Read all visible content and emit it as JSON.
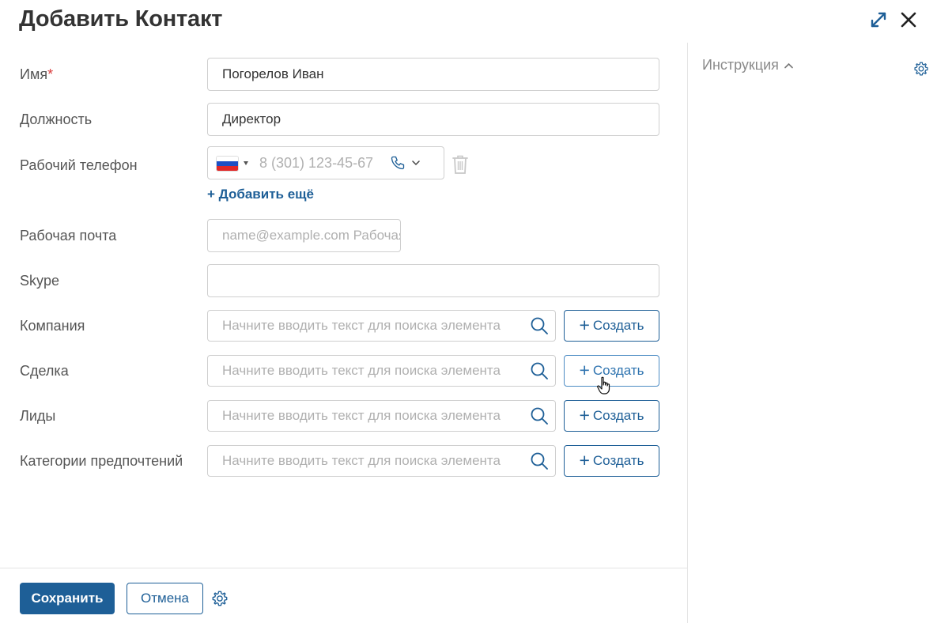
{
  "header": {
    "title": "Добавить Контакт"
  },
  "fields": {
    "name": {
      "label": "Имя",
      "required_mark": "*",
      "value": "Погорелов Иван"
    },
    "position": {
      "label": "Должность",
      "value": "Директор"
    },
    "work_phone": {
      "label": "Рабочий телефон",
      "placeholder": "8 (301) 123-45-67",
      "add_more": "+ Добавить ещё"
    },
    "work_email": {
      "label": "Рабочая почта",
      "placeholder": "name@example.com Рабочая"
    },
    "skype": {
      "label": "Skype",
      "value": ""
    },
    "company": {
      "label": "Компания",
      "placeholder": "Начните вводить текст для поиска элемента",
      "create": "Создать"
    },
    "deal": {
      "label": "Сделка",
      "placeholder": "Начните вводить текст для поиска элемента",
      "create": "Создать"
    },
    "leads": {
      "label": "Лиды",
      "placeholder": "Начните вводить текст для поиска элемента",
      "create": "Создать"
    },
    "preferences": {
      "label": "Категории предпочтений",
      "placeholder": "Начните вводить текст для поиска элемента",
      "create": "Создать"
    }
  },
  "footer": {
    "save": "Сохранить",
    "cancel": "Отмена"
  },
  "side_panel": {
    "instruction": "Инструкция"
  },
  "colors": {
    "accent": "#1e5f97",
    "required": "#d93b3b",
    "border": "#cfcfcf"
  },
  "icons": [
    "expand-icon",
    "close-icon",
    "ru-flag-icon",
    "phone-icon",
    "chevron-down-icon",
    "trash-icon",
    "search-icon",
    "gear-icon",
    "chevron-up-icon",
    "hand-cursor-icon"
  ]
}
